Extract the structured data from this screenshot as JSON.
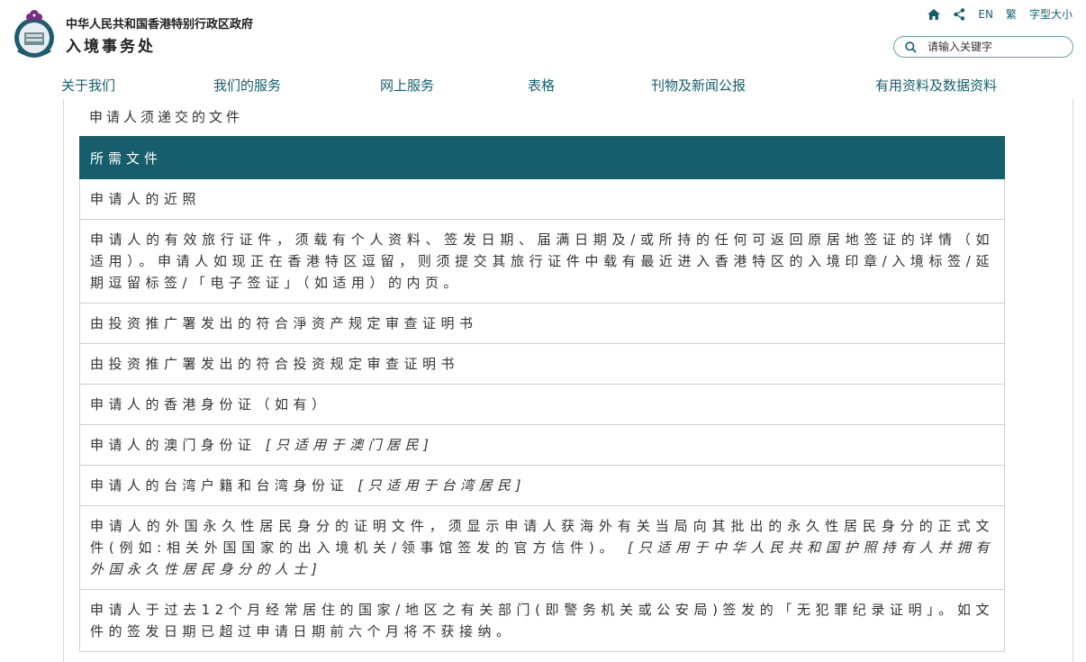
{
  "header": {
    "gov_name": "中华人民共和国香港特别行政区政府",
    "dept_name": "入境事务处",
    "top_links": {
      "home_icon": "home-icon",
      "share_icon": "share-icon",
      "lang_en": "EN",
      "lang_trad": "繁",
      "font_size": "字型大小"
    },
    "search": {
      "icon": "search-icon",
      "placeholder": "请输入关键字"
    }
  },
  "nav": {
    "items": [
      {
        "label": "关于我们"
      },
      {
        "label": "我们的服务"
      },
      {
        "label": "网上服务"
      },
      {
        "label": "表格"
      },
      {
        "label": "刊物及新闻公报"
      },
      {
        "label": "有用资料及数据资料"
      }
    ]
  },
  "content": {
    "section_title": "申请人须递交的文件",
    "table": {
      "header": "所需文件",
      "rows": [
        {
          "text": "申请人的近照",
          "note": ""
        },
        {
          "text": "申请人的有效旅行证件，须载有个人资料、签发日期、届满日期及/或所持的任何可返回原居地签证的详情（如适用）。申请人如现正在香港特区逗留，则须提交其旅行证件中载有最近进入香港特区的入境印章/入境标签/延期逗留标签/「电子签证」（如适用）的内页。",
          "note": ""
        },
        {
          "text": "由投资推广署发出的符合淨资产规定审查证明书",
          "note": ""
        },
        {
          "text": "由投资推广署发出的符合投资规定审查证明书",
          "note": ""
        },
        {
          "text": "申请人的香港身份证（如有）",
          "note": ""
        },
        {
          "text": "申请人的澳门身份证",
          "note": "[只适用于澳门居民]"
        },
        {
          "text": "申请人的台湾户籍和台湾身份证",
          "note": "[只适用于台湾居民]"
        },
        {
          "text": "申请人的外国永久性居民身分的证明文件，须显示申请人获海外有关当局向其批出的永久性居民身分的正式文件(例如:相关外国国家的出入境机关/领事馆签发的官方信件)。",
          "note": "[只适用于中华人民共和国护照持有人并拥有外国永久性居民身分的人士]"
        },
        {
          "text": "申请人于过去12个月经常居住的国家/地区之有关部门(即警务机关或公安局)签发的「无犯罪纪录证明」。如文件的签发日期已超过申请日期前六个月将不获接纳。",
          "note": ""
        }
      ]
    }
  },
  "colors": {
    "brand": "#165e6b",
    "nav_text": "#155f6b",
    "emblem_purple": "#7b2d86"
  }
}
